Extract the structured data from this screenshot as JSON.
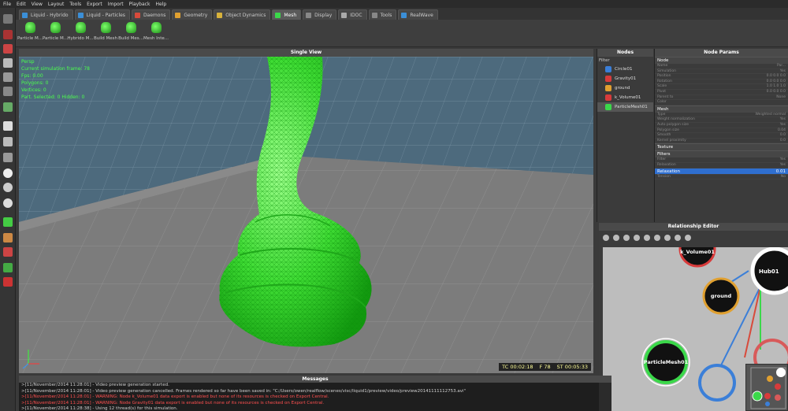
{
  "menu": [
    "File",
    "Edit",
    "View",
    "Layout",
    "Tools",
    "Export",
    "Import",
    "Playback",
    "Help"
  ],
  "tabs": [
    {
      "label": "Liquid - Hybrido",
      "color": "#3b8fd8",
      "active": false
    },
    {
      "label": "Liquid - Particles",
      "color": "#3b8fd8",
      "active": false
    },
    {
      "label": "Daemons",
      "color": "#d84a3b",
      "active": false
    },
    {
      "label": "Geometry",
      "color": "#e0a030",
      "active": false
    },
    {
      "label": "Object Dynamics",
      "color": "#d8b23b",
      "active": false
    },
    {
      "label": "Mesh",
      "color": "#3bd84a",
      "active": true
    },
    {
      "label": "Display",
      "color": "#888888",
      "active": false
    },
    {
      "label": "IDOC",
      "color": "#aaaaaa",
      "active": false
    },
    {
      "label": "Tools",
      "color": "#888888",
      "active": false
    },
    {
      "label": "RealWave",
      "color": "#3b8fd8",
      "active": false
    }
  ],
  "shelf": [
    "Particle M...",
    "Particle M...",
    "Hybrido M...",
    "Build Mesh",
    "Build Mes...",
    "Mesh Inte..."
  ],
  "viewport": {
    "title": "Single View",
    "hud": [
      "Persp",
      "Current simulation frame: 78",
      "Fps: 0.00",
      "Polygons: 0",
      "Vertices: 0",
      "Part. Selected: 0 Hidden: 0"
    ],
    "timecode": "TC 00:02:18",
    "frame": "F 78",
    "simtime": "ST 00:05:33"
  },
  "nodes": {
    "title": "Nodes",
    "filter_label": "Filter",
    "items": [
      {
        "label": "Circle01",
        "color": "#3b7fd8",
        "selected": false
      },
      {
        "label": "Gravity01",
        "color": "#d83b3b",
        "selected": false
      },
      {
        "label": "ground",
        "color": "#e0a030",
        "selected": false
      },
      {
        "label": "k_Volume01",
        "color": "#d83b3b",
        "selected": false
      },
      {
        "label": "ParticleMesh01",
        "color": "#3bd84a",
        "selected": true
      }
    ]
  },
  "params": {
    "title": "Node Params",
    "sections": {
      "node": "Node",
      "mesh": "Mesh",
      "texture": "Texture",
      "filters": "Filters"
    },
    "node_rows": [
      {
        "label": "Name",
        "value": "Par..."
      },
      {
        "label": "Simulation",
        "value": "Yes"
      },
      {
        "label": "Position",
        "value": "0.0   0.0   0.0"
      },
      {
        "label": "Rotation",
        "value": "0.0   0.0   0.0"
      },
      {
        "label": "Scale",
        "value": "1.0   1.0   1.0"
      },
      {
        "label": "Pivot",
        "value": "0.0   0.0   0.0"
      },
      {
        "label": "Parent to",
        "value": "None"
      },
      {
        "label": "Color",
        "value": ""
      }
    ],
    "mesh_rows": [
      {
        "label": "Type",
        "value": "Weighted normal"
      },
      {
        "label": "Weight normalization",
        "value": "Yes"
      },
      {
        "label": "Auto polygon size",
        "value": "Yes"
      },
      {
        "label": "Polygon size",
        "value": "0.04"
      },
      {
        "label": "Smooth",
        "value": "0.0"
      },
      {
        "label": "Kernel proximity",
        "value": "0.0"
      }
    ],
    "filter_rows": [
      {
        "label": "Filter",
        "value": "Yes"
      },
      {
        "label": "Relaxation",
        "value": "Yes"
      },
      {
        "label": "Tension",
        "value": "No"
      }
    ],
    "highlight": {
      "label": "Relaxation",
      "value": "0.01"
    }
  },
  "relationship": {
    "title": "Relationship Editor",
    "nodes": [
      "k_Volume01",
      "Hub01",
      "ground",
      "ParticleMesh01"
    ]
  },
  "messages": {
    "title": "Messages",
    "lines": [
      {
        "text": ">[11/November/2014 11:28:01] - Video preview generation started.",
        "color": "#d0d0d0"
      },
      {
        "text": ">[11/November/2014 11:28:01] - Video preview generation cancelled. Frames rendered so far have been saved in: \"C:/Users/owen/realflow/scenes/visc/liquid1/preview/video/preview20141111112753.avi\"",
        "color": "#d0d0d0"
      },
      {
        "text": ">[11/November/2014 11:28:01] - WARNING: Node k_Volume01 data export is enabled but none of its resources is checked on Export Central.",
        "color": "#ff5050"
      },
      {
        "text": ">[11/November/2014 11:28:01] - WARNING: Node Gravity01 data export is enabled but none of its resources is checked on Export Central.",
        "color": "#ff5050"
      },
      {
        "text": ">[11/November/2014 11:28:38] - Using 12 thread(s) for this simulation.",
        "color": "#d0d0d0"
      }
    ]
  }
}
